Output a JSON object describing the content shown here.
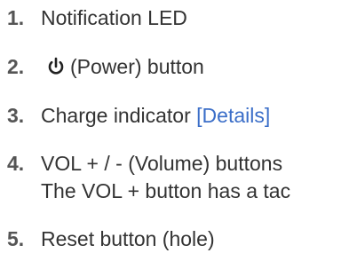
{
  "items": [
    {
      "num": "1.",
      "text": "Notification LED"
    },
    {
      "num": "2.",
      "text": "(Power) button",
      "icon": "power-icon"
    },
    {
      "num": "3.",
      "text": "Charge indicator ",
      "link": "[Details]"
    },
    {
      "num": "4.",
      "text": "VOL + / - (Volume) buttons",
      "subtext": "The VOL + button has a tac"
    },
    {
      "num": "5.",
      "text": "Reset button (hole)"
    }
  ],
  "colors": {
    "text": "#333333",
    "number": "#555555",
    "link": "#3b6ec8"
  }
}
